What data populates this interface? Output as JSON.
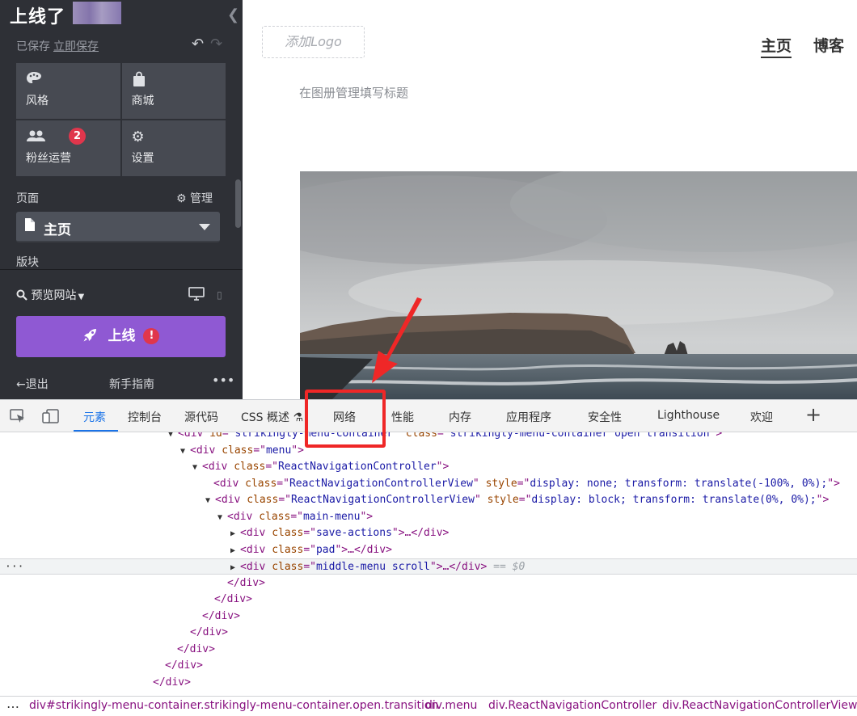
{
  "sidebar": {
    "site_title": "上线了",
    "saved_status": "已保存",
    "save_now": "立即保存",
    "tiles": [
      {
        "label": "风格",
        "icon": "palette-icon"
      },
      {
        "label": "商城",
        "icon": "shopping-bag-icon"
      },
      {
        "label": "粉丝运营",
        "icon": "users-icon",
        "badge": "2"
      },
      {
        "label": "设置",
        "icon": "gear-icon"
      }
    ],
    "pages_label": "页面",
    "manage_label": "管理",
    "current_page": "主页",
    "sections_label": "版块",
    "preview_label": "预览网站",
    "publish_label": "上线",
    "exit_label": "退出",
    "guide_label": "新手指南",
    "accent": "#8f59d3"
  },
  "site": {
    "logo_placeholder": "添加Logo",
    "nav": [
      "主页",
      "博客"
    ],
    "hint_text": "在图册管理填写标题"
  },
  "devtools": {
    "tabs": [
      "元素",
      "控制台",
      "源代码",
      "CSS 概述",
      "网络",
      "性能",
      "内存",
      "应用程序",
      "安全性",
      "Lighthouse",
      "欢迎"
    ],
    "active_tab": "元素",
    "highlighted_tab": "网络",
    "code_lines": [
      {
        "prefix": "▼ ",
        "tag": "div",
        "attrs": [
          [
            "id",
            "strikingly-menu-container"
          ],
          [
            "class",
            "strikingly-menu-container open transition"
          ]
        ],
        "close": ">"
      },
      {
        "prefix": "▼ ",
        "tag": "div",
        "attrs": [
          [
            "class",
            "menu"
          ]
        ],
        "close": ">"
      },
      {
        "prefix": "▼ ",
        "tag": "div",
        "attrs": [
          [
            "class",
            "ReactNavigationController"
          ]
        ],
        "close": ">"
      },
      {
        "prefix": "",
        "tag": "div",
        "attrs": [
          [
            "class",
            "ReactNavigationControllerView"
          ],
          [
            "style",
            "display: none; transform: translate(-100%, 0%);"
          ]
        ],
        "close": ">"
      },
      {
        "prefix": "▼ ",
        "tag": "div",
        "attrs": [
          [
            "class",
            "ReactNavigationControllerView"
          ],
          [
            "style",
            "display: block; transform: translate(0%, 0%);"
          ]
        ],
        "close": ">"
      },
      {
        "prefix": "▼ ",
        "tag": "div",
        "attrs": [
          [
            "class",
            "main-menu"
          ]
        ],
        "close": ">"
      },
      {
        "prefix": "▶ ",
        "tag": "div",
        "attrs": [
          [
            "class",
            "save-actions"
          ]
        ],
        "close": ">…</div>"
      },
      {
        "prefix": "▶ ",
        "tag": "div",
        "attrs": [
          [
            "class",
            "pad"
          ]
        ],
        "close": ">…</div>"
      },
      {
        "prefix": "▶ ",
        "tag": "div",
        "attrs": [
          [
            "class",
            "middle-menu scroll"
          ]
        ],
        "close": ">…</div>",
        "selected": true,
        "suffix": " == $0"
      },
      {
        "prefix": "",
        "text": "</div>"
      },
      {
        "prefix": "",
        "text": "</div>"
      },
      {
        "prefix": "",
        "text": "</div>"
      },
      {
        "prefix": "",
        "text": "</div>"
      },
      {
        "prefix": "",
        "text": "</div>"
      },
      {
        "prefix": "",
        "text": "</div>"
      },
      {
        "prefix": "",
        "text": "</div>"
      }
    ],
    "selected_ellipsis": "···",
    "breadcrumbs": [
      "div#strikingly-menu-container.strikingly-menu-container.open.transition",
      "div.menu",
      "div.ReactNavigationController",
      "div.ReactNavigationControllerView"
    ],
    "more_glyph": "…",
    "highlight_color": "#ef2727"
  }
}
